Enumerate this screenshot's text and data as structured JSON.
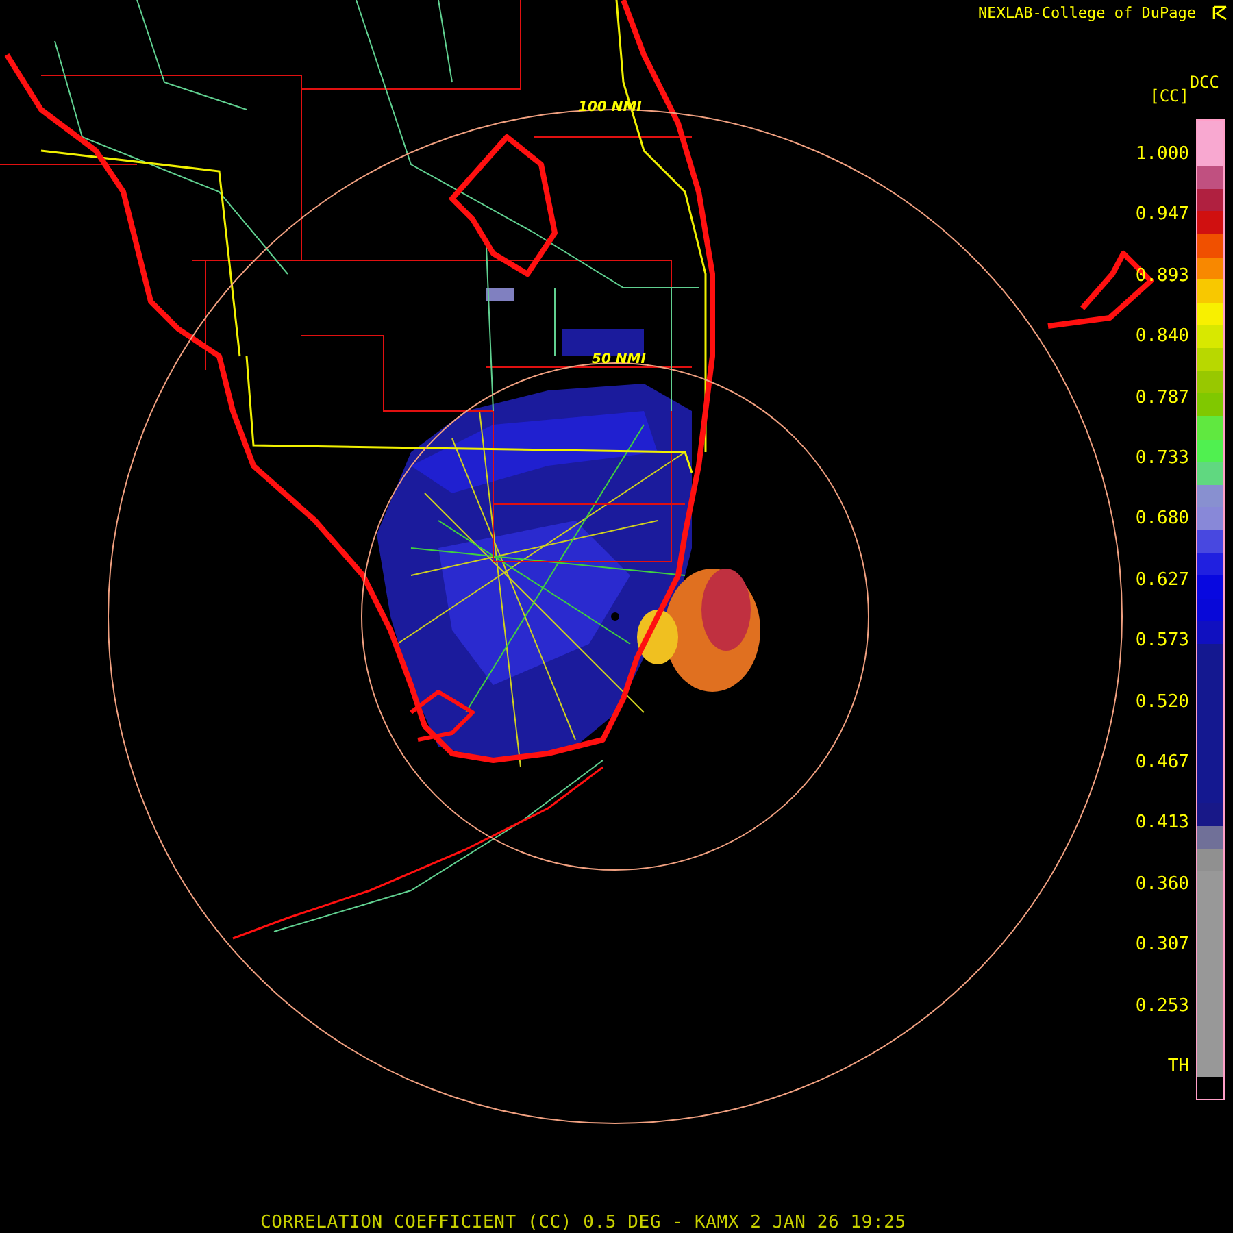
{
  "header": {
    "credit": "NEXLAB-College of DuPage",
    "product_code": "DCC",
    "unit": "[CC]"
  },
  "map": {
    "range_rings": [
      {
        "label": "100 NMI"
      },
      {
        "label": "50 NMI"
      }
    ]
  },
  "legend": {
    "labels": [
      "1.000",
      "0.947",
      "0.893",
      "0.840",
      "0.787",
      "0.733",
      "0.680",
      "0.627",
      "0.573",
      "0.520",
      "0.467",
      "0.413",
      "0.360",
      "0.307",
      "0.253",
      "TH"
    ]
  },
  "caption": "CORRELATION COEFFICIENT (CC) 0.5 DEG - KAMX 2 JAN 26 19:25"
}
